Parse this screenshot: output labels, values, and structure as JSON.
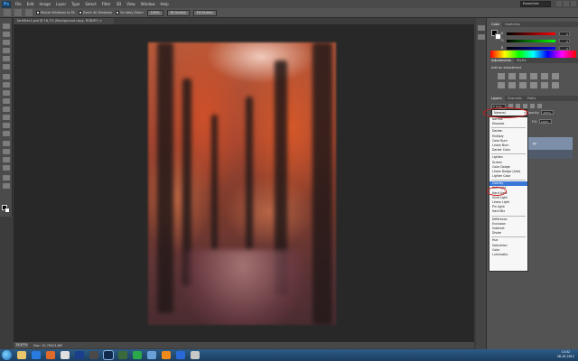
{
  "menu": {
    "logo": "Ps",
    "items": [
      "File",
      "Edit",
      "Image",
      "Layer",
      "Type",
      "Select",
      "Filter",
      "3D",
      "View",
      "Window",
      "Help"
    ],
    "workspace": "Essentials"
  },
  "options": {
    "resize_windows": "Resize Windows to Fit",
    "zoom_all": "Zoom All Windows",
    "scrubby_zoom": "Scrubby Zoom",
    "actual_pixels": "100%",
    "fit_screen": "Fit Screen",
    "fill_screen": "Fill Screen"
  },
  "document": {
    "tab_title": "forrfilter1.psd @ 16,7% (Background copy, RGB/8*) ×"
  },
  "status": {
    "zoom": "16,67%",
    "doc_info": "Doc: 10,7M/24,6M"
  },
  "color_panel": {
    "tabs": [
      "Color",
      "Swatches"
    ],
    "r": {
      "label": "R",
      "value": "0"
    },
    "g": {
      "label": "G",
      "value": "0"
    },
    "b": {
      "label": "B",
      "value": "0"
    }
  },
  "adjustments_panel": {
    "tabs": [
      "Adjustments",
      "Styles"
    ],
    "title": "Add an adjustment"
  },
  "layers_panel": {
    "tabs": [
      "Layers",
      "Channels",
      "Paths"
    ],
    "kind": "P Kind",
    "opacity_label": "Opacity:",
    "opacity_value": "100%",
    "fill_label": "Fill:",
    "fill_value": "100%",
    "layer_name": "py"
  },
  "blend_mode": {
    "selected": "Normal",
    "groups": [
      [
        "Normal",
        "Dissolve"
      ],
      [
        "Darken",
        "Multiply",
        "Color Burn",
        "Linear Burn",
        "Darker Color"
      ],
      [
        "Lighten",
        "Screen",
        "Color Dodge",
        "Linear Dodge (Add)",
        "Lighter Color"
      ],
      [
        "Overlay",
        "Soft Light",
        "Hard Light",
        "Vivid Light",
        "Linear Light",
        "Pin Light",
        "Hard Mix"
      ],
      [
        "Difference",
        "Exclusion",
        "Subtract",
        "Divide"
      ],
      [
        "Hue",
        "Saturation",
        "Color",
        "Luminosity"
      ]
    ],
    "highlighted": "Overlay"
  },
  "taskbar": {
    "time": "14:32",
    "date": "26-10-2012"
  },
  "colors": {
    "highlight": "#3a78d8",
    "annotation": "#d21a1a",
    "layer_selected": "#7d8ea8"
  }
}
